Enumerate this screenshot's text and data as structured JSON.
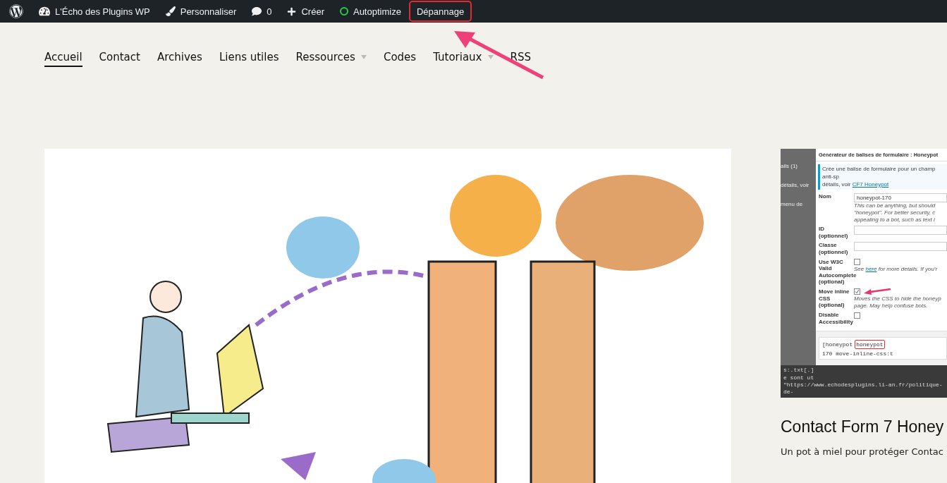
{
  "admin_bar": {
    "items": [
      {
        "kind": "logo",
        "highlighted": false
      },
      {
        "kind": "site",
        "label": "L'Écho des Plugins WP",
        "highlighted": false
      },
      {
        "kind": "customize",
        "label": "Personnaliser",
        "highlighted": false
      },
      {
        "kind": "comments",
        "label": "0",
        "highlighted": false
      },
      {
        "kind": "new",
        "label": "Créer",
        "highlighted": false
      },
      {
        "kind": "status",
        "label": "Autoptimize",
        "highlighted": false
      },
      {
        "kind": "plain",
        "label": "Dépannage",
        "highlighted": true
      }
    ]
  },
  "nav": [
    {
      "label": "Accueil",
      "selected": true,
      "has_submenu": false
    },
    {
      "label": "Contact",
      "selected": false,
      "has_submenu": false
    },
    {
      "label": "Archives",
      "selected": false,
      "has_submenu": false
    },
    {
      "label": "Liens utiles",
      "selected": false,
      "has_submenu": false
    },
    {
      "label": "Ressources",
      "selected": false,
      "has_submenu": true
    },
    {
      "label": "Codes",
      "selected": false,
      "has_submenu": false
    },
    {
      "label": "Tutoriaux",
      "selected": false,
      "has_submenu": true
    },
    {
      "label": "RSS",
      "selected": false,
      "has_submenu": false
    }
  ],
  "sidebar": {
    "thumbnail": {
      "left_strip": [
        "ails (1)",
        "détails, voir",
        "menu de"
      ],
      "title": "Générateur de balises de formulaire : Honeypot",
      "notice": "Crée une balise de formulaire pour un champ anti-sp",
      "notice_line2": "détails, voir",
      "notice_link": "CF7 Honeypot",
      "fields": [
        {
          "kind": "text",
          "label": "Nom",
          "value": "honeypot-170",
          "help": [
            "This can be anything, but should",
            "\"honeypot\". For better security, c",
            "appealing to a bot, such as text i"
          ]
        },
        {
          "kind": "text",
          "label": "ID (optionnel)"
        },
        {
          "kind": "text",
          "label": "Classe (optionnel)"
        },
        {
          "kind": "checkbox",
          "label": "Use W3C Valid Autocomplete (optional)",
          "checked": false,
          "help_link": "here",
          "help_prefix": "See",
          "help": [
            "for more details. If you'r"
          ]
        },
        {
          "kind": "checkbox",
          "label": "Move inline CSS (optional)",
          "checked": true,
          "help": [
            "Moves the CSS to hide the honeyp",
            "page. May help confuse bots."
          ]
        },
        {
          "kind": "checkbox",
          "label": "Disable Accessibility",
          "checked": false
        }
      ],
      "code": {
        "before": "[honeypot",
        "highlight": "honeypot",
        "after": "170 move-inline-css:t"
      },
      "bottom_code": [
        "s:.txt[.]",
        "e sont ut",
        "\"https://www.echodesplugins.li-an.fr/politique-de-"
      ]
    },
    "title": "Contact Form 7 Honey",
    "excerpt": "Un pot à miel pour protéger Contac"
  }
}
